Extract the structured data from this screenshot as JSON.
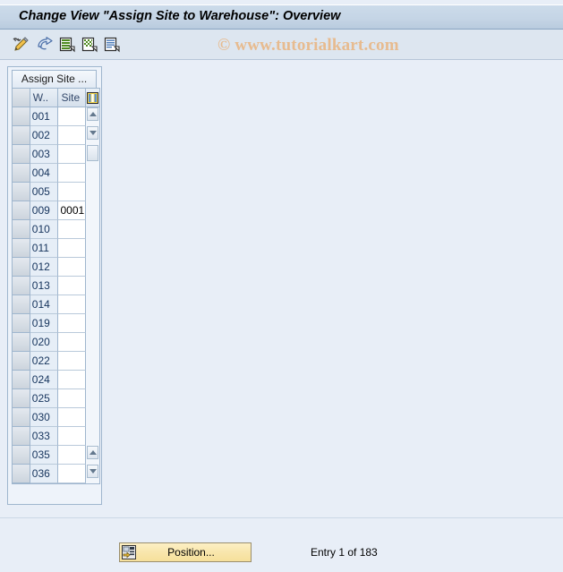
{
  "window": {
    "title": "Change View \"Assign Site to Warehouse\": Overview"
  },
  "watermark": {
    "text": "© www.tutorialkart.com",
    "color": "#e8b98a"
  },
  "toolbar": {
    "buttons": [
      {
        "name": "change-display-icon",
        "tooltip": "Display -> Change"
      },
      {
        "name": "undo-icon",
        "tooltip": "Undo"
      },
      {
        "name": "new-entries-icon",
        "tooltip": "New Entries"
      },
      {
        "name": "copy-as-icon",
        "tooltip": "Copy As..."
      },
      {
        "name": "details-icon",
        "tooltip": "Details"
      }
    ]
  },
  "table_panel": {
    "tab_label": "Assign Site ...",
    "columns": [
      {
        "key": "warehouse",
        "label": "W.."
      },
      {
        "key": "site",
        "label": "Site"
      }
    ],
    "config_icon": "column-config-icon",
    "rows": [
      {
        "warehouse": "001",
        "site": ""
      },
      {
        "warehouse": "002",
        "site": ""
      },
      {
        "warehouse": "003",
        "site": ""
      },
      {
        "warehouse": "004",
        "site": ""
      },
      {
        "warehouse": "005",
        "site": ""
      },
      {
        "warehouse": "009",
        "site": "0001"
      },
      {
        "warehouse": "010",
        "site": ""
      },
      {
        "warehouse": "011",
        "site": ""
      },
      {
        "warehouse": "012",
        "site": ""
      },
      {
        "warehouse": "013",
        "site": ""
      },
      {
        "warehouse": "014",
        "site": ""
      },
      {
        "warehouse": "019",
        "site": ""
      },
      {
        "warehouse": "020",
        "site": ""
      },
      {
        "warehouse": "022",
        "site": ""
      },
      {
        "warehouse": "024",
        "site": ""
      },
      {
        "warehouse": "025",
        "site": ""
      },
      {
        "warehouse": "030",
        "site": ""
      },
      {
        "warehouse": "033",
        "site": ""
      },
      {
        "warehouse": "035",
        "site": ""
      },
      {
        "warehouse": "036",
        "site": ""
      }
    ]
  },
  "footer": {
    "position_button_label": "Position...",
    "position_button_icon": "position-icon",
    "entry_status": "Entry 1 of 183"
  },
  "colors": {
    "page_background": "#e8eef7",
    "titlebar": "#c5d5e6",
    "toolbar": "#dde6f0",
    "grid_border": "#9fb6ce",
    "key_column": "#e6eef7",
    "button_yellow": "#f8e6ac"
  }
}
